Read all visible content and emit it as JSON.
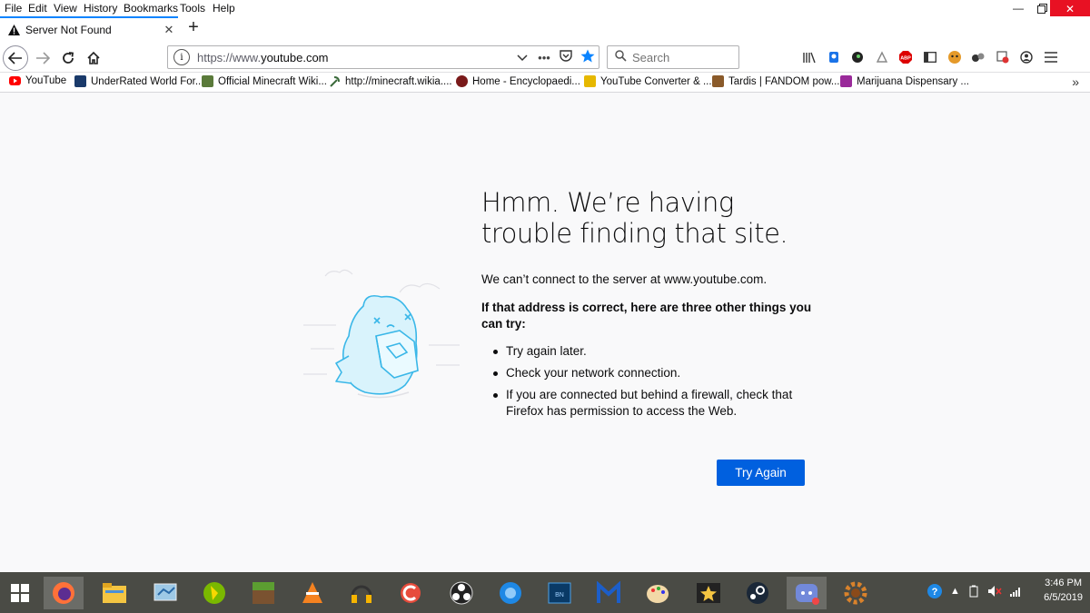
{
  "menu": [
    "File",
    "Edit",
    "View",
    "History",
    "Bookmarks",
    "Tools",
    "Help"
  ],
  "menu_underline": [
    "F",
    "E",
    "V",
    "s",
    "B",
    "T",
    "H"
  ],
  "tab": {
    "title": "Server Not Found",
    "close": "✕"
  },
  "newtab": "+",
  "url": {
    "prefix": "https://www.",
    "domain": "youtube.com"
  },
  "search": {
    "placeholder": "Search"
  },
  "bookmarks": [
    {
      "label": "YouTube",
      "color": "#ff0000"
    },
    {
      "label": "UnderRated World For...",
      "color": "#1a3a6a"
    },
    {
      "label": "Official Minecraft Wiki...",
      "color": "#5a7a3a"
    },
    {
      "label": "http://minecraft.wikia....",
      "color": "#3a6a3a"
    },
    {
      "label": "Home - Encyclopaedi...",
      "color": "#7a1a1a"
    },
    {
      "label": "YouTube Converter & ...",
      "color": "#e6b800"
    },
    {
      "label": "Tardis | FANDOM pow...",
      "color": "#8a5a2a"
    },
    {
      "label": "Marijuana Dispensary ...",
      "color": "#9a2a9a"
    }
  ],
  "error": {
    "title": "Hmm. We’re having trouble finding that site.",
    "description": "We can’t connect to the server at www.youtube.com.",
    "subheading": "If that address is correct, here are three other things you can try:",
    "suggestions": [
      "Try again later.",
      "Check your network connection.",
      "If you are connected but behind a firewall, check that Firefox has permission to access the Web."
    ],
    "button": "Try Again"
  },
  "clock": {
    "time": "3:46 PM",
    "date": "6/5/2019"
  },
  "accent": "#0060df"
}
